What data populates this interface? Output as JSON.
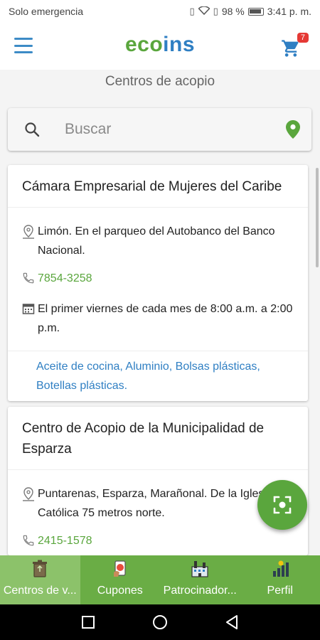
{
  "status": {
    "carrier": "Solo emergencia",
    "battery": "98 %",
    "time": "3:41 p. m."
  },
  "header": {
    "logo_part1": "eco",
    "logo_part2": "ins",
    "cart_count": "7",
    "accent": "#5aa63d",
    "brand_blue": "#2f7fc3"
  },
  "page": {
    "title": "Centros de acopio"
  },
  "search": {
    "placeholder": "Buscar"
  },
  "centers": [
    {
      "name": "Cámara Empresarial de Mujeres del Caribe",
      "address": "Limón. En el parqueo del Autobanco del Banco Nacional.",
      "phone": "7854-3258",
      "schedule": "El primer viernes de cada mes de 8:00 a.m. a 2:00 p.m.",
      "materials": "Aceite de cocina, Aluminio, Bolsas plásticas, Botellas plásticas."
    },
    {
      "name": "Centro de Acopio de la Municipalidad de Esparza",
      "address": "Puntarenas, Esparza, Marañonal. De la Iglesia Católica 75 metros norte.",
      "phone": "2415-1578"
    }
  ],
  "nav": [
    {
      "label": "Centros de v...",
      "icon": "recycle-bin-icon"
    },
    {
      "label": "Cupones",
      "icon": "coupon-icon"
    },
    {
      "label": "Patrocinador...",
      "icon": "factory-icon"
    },
    {
      "label": "Perfil",
      "icon": "profile-chart-icon"
    }
  ]
}
